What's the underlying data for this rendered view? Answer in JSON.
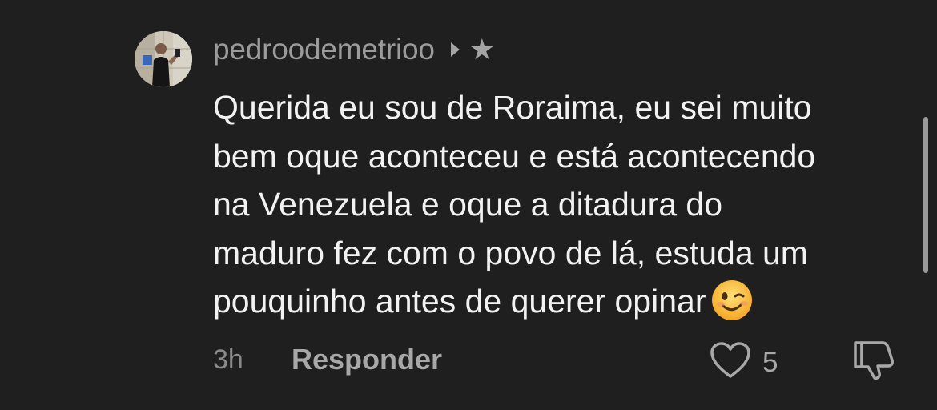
{
  "comment": {
    "username": "pedroodemetrioo",
    "caret_icon": "caret-right-icon",
    "star_icon": "star-icon",
    "star_glyph": "★",
    "text_lines": [
      "Querida eu sou de Roraima, eu sei muito",
      "bem oque aconteceu e está acontecendo",
      "na Venezuela e oque a ditadura do",
      "maduro fez com o povo de lá, estuda um",
      "pouquinho antes de querer opinar"
    ],
    "emoji": "winking-face-emoji",
    "time": "3h",
    "reply_label": "Responder",
    "like_icon": "heart-icon",
    "like_count": "5",
    "dislike_icon": "thumbs-down-icon"
  },
  "colors": {
    "background": "#1f1f1f",
    "text": "#f2f2f2",
    "muted": "#9b9b9b"
  }
}
